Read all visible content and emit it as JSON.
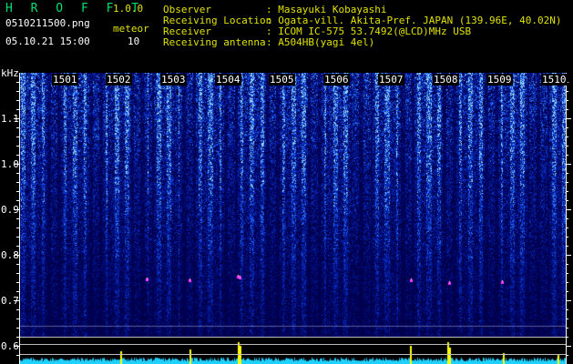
{
  "app": {
    "name": "H R O F F T",
    "version": "1.0.0"
  },
  "file": {
    "name": "0510211500.png",
    "datetime": "05.10.21 15:00"
  },
  "meteor": {
    "label": "meteor",
    "count": "10"
  },
  "station": {
    "rows": [
      {
        "label": "Observer",
        "value": ": Masayuki Kobayashi"
      },
      {
        "label": "Receiving Location",
        "value": ": Ogata-vill. Akita-Pref. JAPAN (139.96E, 40.02N)"
      },
      {
        "label": "Receiver",
        "value": ": ICOM IC-575 53.7492(@LCD)MHz USB"
      },
      {
        "label": "Receiving antenna",
        "value": ": A504HB(yagi 4el)"
      }
    ]
  },
  "axis": {
    "unit": "kHz",
    "y_ticks": [
      "1.1",
      "1.0",
      "0.9",
      "0.8",
      "0.7",
      "0.6"
    ],
    "minutes": [
      "1501",
      "1502",
      "1503",
      "1504",
      "1505",
      "1506",
      "1507",
      "1508",
      "1509",
      "1510"
    ]
  },
  "colors": {
    "title": "#00e070",
    "version": "#e0e000",
    "header_text": "#e0e000",
    "noise_dark": "#00005a",
    "noise_bright": "#4a80ff",
    "strip": "#20d0ff",
    "echo": "#ffff00"
  }
}
